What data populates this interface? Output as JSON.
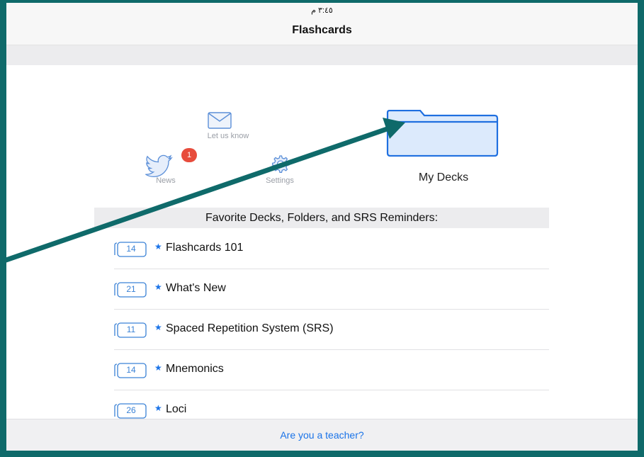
{
  "status_bar": {
    "time": "٣:٤٥ م"
  },
  "nav": {
    "title": "Flashcards"
  },
  "shortcuts": {
    "feedback_label": "Let us know",
    "news_label": "News",
    "news_badge": "1",
    "settings_label": "Settings",
    "my_decks_label": "My Decks"
  },
  "favorites": {
    "header": "Favorite Decks, Folders, and SRS Reminders:",
    "items": [
      {
        "count": "14",
        "name": "Flashcards 101"
      },
      {
        "count": "21",
        "name": "What's New"
      },
      {
        "count": "11",
        "name": "Spaced Repetition System (SRS)"
      },
      {
        "count": "14",
        "name": "Mnemonics"
      },
      {
        "count": "26",
        "name": "Loci"
      }
    ]
  },
  "footer": {
    "teacher_link": "Are you a teacher?"
  },
  "colors": {
    "frame": "#0f6a6a",
    "accent": "#1a73e8",
    "badge": "#e74c3c",
    "folder_fill": "#dceafc"
  }
}
